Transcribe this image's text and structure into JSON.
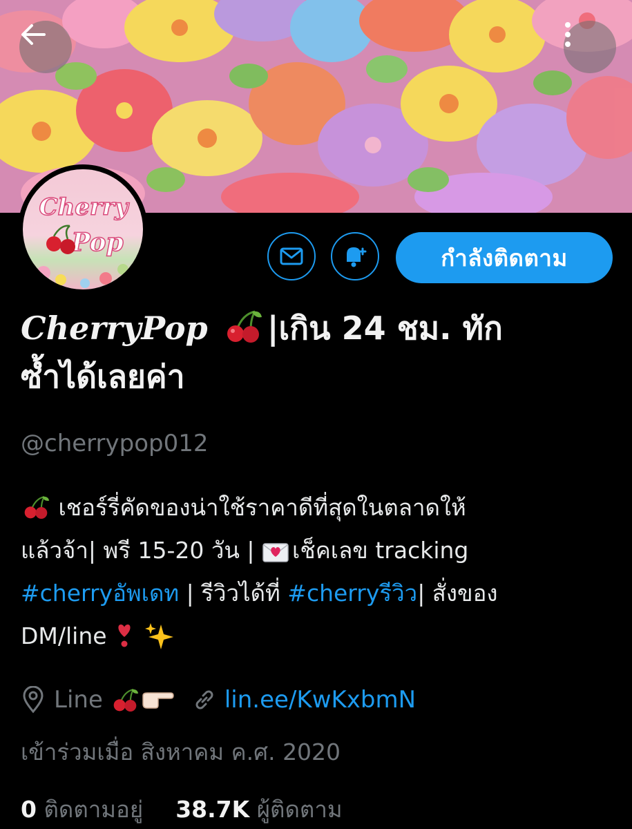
{
  "header": {
    "back_icon": "arrow-left-icon",
    "more_icon": "more-vertical-icon"
  },
  "avatar": {
    "text_top": "Cherry",
    "text_bottom": "Pop"
  },
  "actions": {
    "message_icon": "mail-icon",
    "notify_icon": "bell-plus-icon",
    "follow_label": "กำลังติดตาม"
  },
  "profile": {
    "name_brand": "CherryPop",
    "name_rest_line1": "|เกิน 24 ชม. ทัก",
    "name_line2": "ซ้ำได้เลยค่า",
    "handle": "@cherrypop012"
  },
  "bio": {
    "line1": "เชอร์รี่คัดของน่าใช้ราคาดีที่สุดในตลาดให้",
    "line2_a": "แล้วจ้า| พรี 15-20 วัน |",
    "line2_b": "เช็คเลข tracking",
    "hashtag1": "#cherryอัพเดท",
    "line3_mid": " | รีวิวได้ที่ ",
    "hashtag2": "#cherryรีวิว",
    "line3_end": "| สั่งของ",
    "line4": "DM/line"
  },
  "meta": {
    "location": "Line",
    "link": "lin.ee/KwKxbmN",
    "joined": "เข้าร่วมเมื่อ สิงหาคม ค.ศ. 2020"
  },
  "stats": {
    "following_count": "0",
    "following_label": "ติดตามอยู่",
    "followers_count": "38.7K",
    "followers_label": "ผู้ติดตาม"
  },
  "colors": {
    "accent": "#1d9bf0",
    "background": "#000000",
    "secondary_text": "#71767b"
  }
}
